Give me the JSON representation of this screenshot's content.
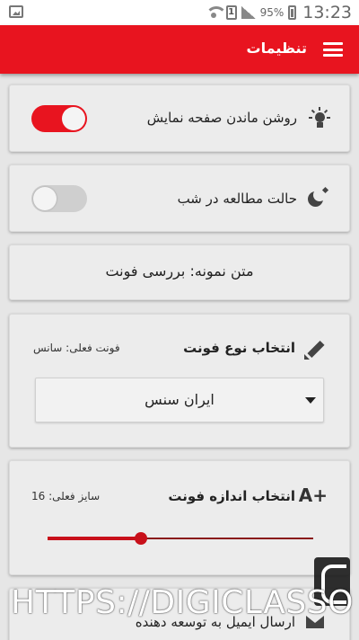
{
  "status_bar": {
    "battery": "95%",
    "sim_label": "1",
    "time": "13:23"
  },
  "app_bar": {
    "title": "تنظیمات",
    "menu_icon": "hamburger-menu-icon"
  },
  "colors": {
    "accent": "#e8141f",
    "background": "#e6e6e6",
    "card": "#ececec"
  },
  "settings": {
    "keep_screen_on": {
      "label": "روشن ماندن صفحه نمایش",
      "icon": "lightbulb-icon",
      "enabled": true
    },
    "night_mode": {
      "label": "حالت مطالعه در شب",
      "icon": "moon-icon",
      "enabled": false
    },
    "sample_text": "متن نمونه: بررسی فونت",
    "font_type": {
      "title": "انتخاب نوع فونت",
      "current": "فونت فعلی: سانس",
      "icon": "pencil-icon",
      "selected_option": "ایران سنس"
    },
    "font_size": {
      "title": "انتخاب اندازه فونت",
      "current": "سایز فعلی: 16",
      "icon": "font-size-icon",
      "icon_text": "A+",
      "slider_fraction": 0.35
    },
    "email": {
      "label": "ارسال ایمیل به توسعه دهنده",
      "icon": "mail-icon"
    }
  },
  "watermark": {
    "text": "HTTPS://DIGICLASSO"
  }
}
